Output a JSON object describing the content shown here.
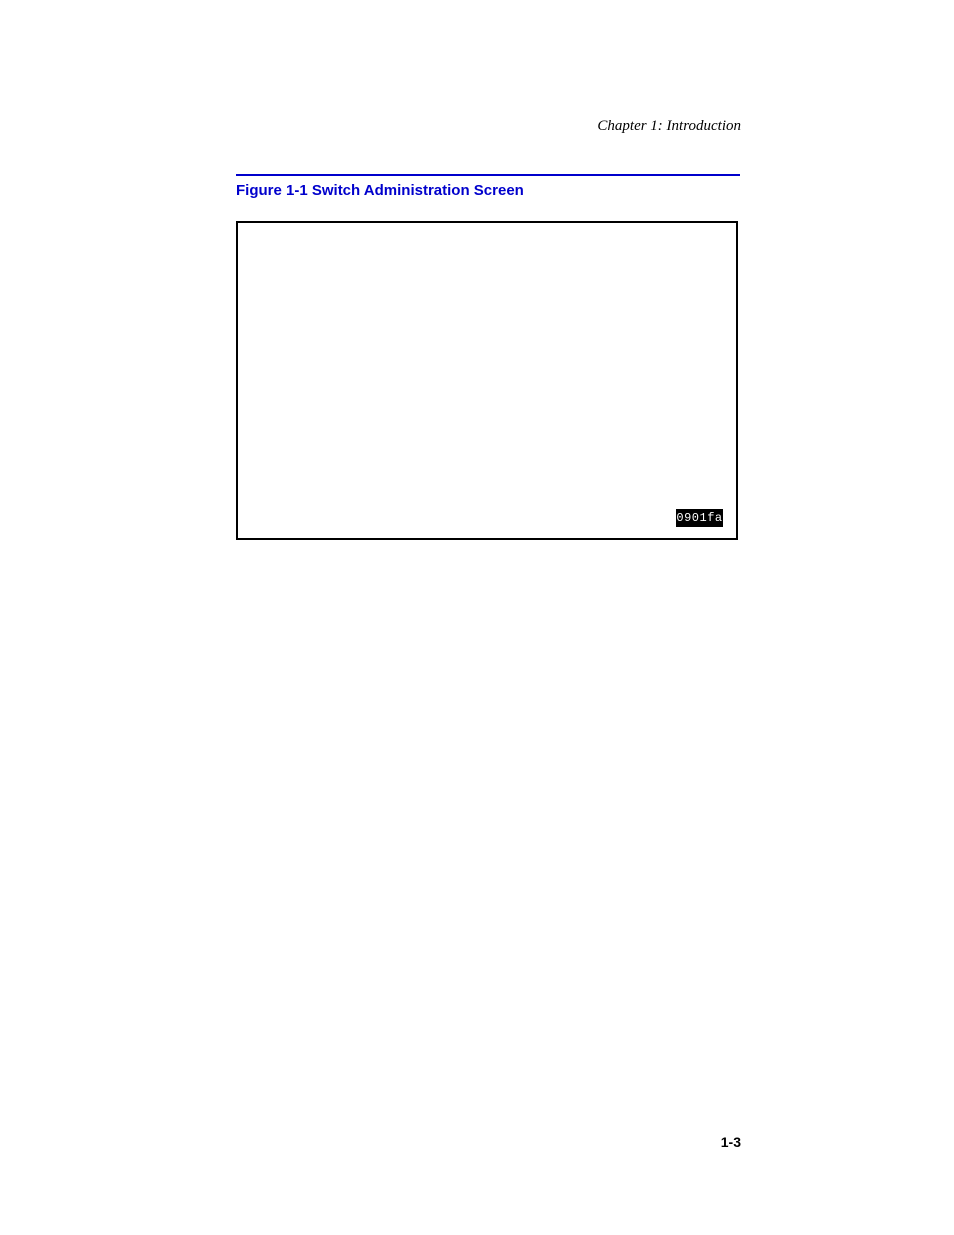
{
  "header": {
    "running_title": "Chapter 1: Introduction"
  },
  "figure": {
    "caption": "Figure 1-1 Switch Administration Screen",
    "screen_id_tag": "0901fa"
  },
  "footer": {
    "page_number": "1-3"
  }
}
